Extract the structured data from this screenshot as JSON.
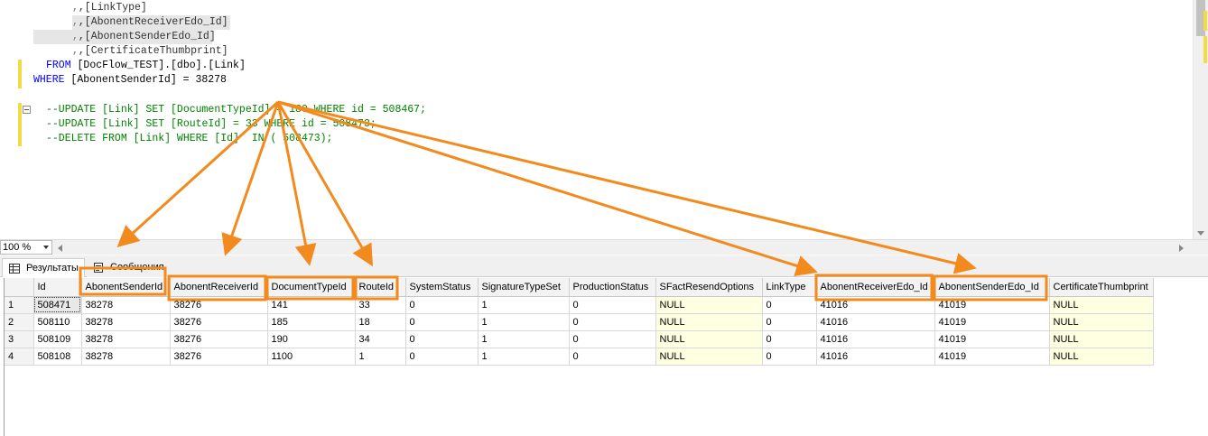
{
  "editor": {
    "lines": [
      {
        "text": ",[LinkType]"
      },
      {
        "text": ",[AbonentReceiverEdo_Id]"
      },
      {
        "text": ",[AbonentSenderEdo_Id]"
      },
      {
        "text": ",[CertificateThumbprint]"
      },
      {
        "kw": "FROM",
        "rest": " [DocFlow_TEST].[dbo].[Link]"
      },
      {
        "kw": "WHERE",
        "rest": " [AbonentSenderId] = 38278"
      },
      {
        "text": ""
      },
      {
        "text": "--UPDATE [Link] SET [DocumentTypeId] = 180 WHERE id = 508467;"
      },
      {
        "text": "--UPDATE [Link] SET [RouteId] = 33 WHERE id = 508473;"
      },
      {
        "text": "--DELETE FROM [Link] WHERE [Id]  IN ( 508473);"
      }
    ]
  },
  "zoom": {
    "value": "100 %"
  },
  "tabs": {
    "results": "Результаты",
    "messages": "Сообщения"
  },
  "grid": {
    "columns": [
      "Id",
      "AbonentSenderId",
      "AbonentReceiverId",
      "DocumentTypeId",
      "RouteId",
      "SystemStatus",
      "SignatureTypeSet",
      "ProductionStatus",
      "SFactResendOptions",
      "LinkType",
      "AbonentReceiverEdo_Id",
      "AbonentSenderEdo_Id",
      "CertificateThumbprint"
    ],
    "rows": [
      [
        "1",
        "508471",
        "38278",
        "38276",
        "141",
        "33",
        "0",
        "1",
        "0",
        "NULL",
        "0",
        "41016",
        "41019",
        "NULL"
      ],
      [
        "2",
        "508110",
        "38278",
        "38276",
        "185",
        "18",
        "0",
        "1",
        "0",
        "NULL",
        "0",
        "41016",
        "41019",
        "NULL"
      ],
      [
        "3",
        "508109",
        "38278",
        "38276",
        "190",
        "34",
        "0",
        "1",
        "0",
        "NULL",
        "0",
        "41016",
        "41019",
        "NULL"
      ],
      [
        "4",
        "508108",
        "38278",
        "38276",
        "1100",
        "1",
        "0",
        "1",
        "0",
        "NULL",
        "0",
        "41016",
        "41019",
        "NULL"
      ]
    ]
  },
  "annotation": {
    "color": "#f28a1e",
    "highlighted_columns": [
      "AbonentSenderId",
      "AbonentReceiverId",
      "DocumentTypeId",
      "RouteId",
      "AbonentReceiverEdo_Id",
      "AbonentSenderEdo_Id"
    ]
  }
}
